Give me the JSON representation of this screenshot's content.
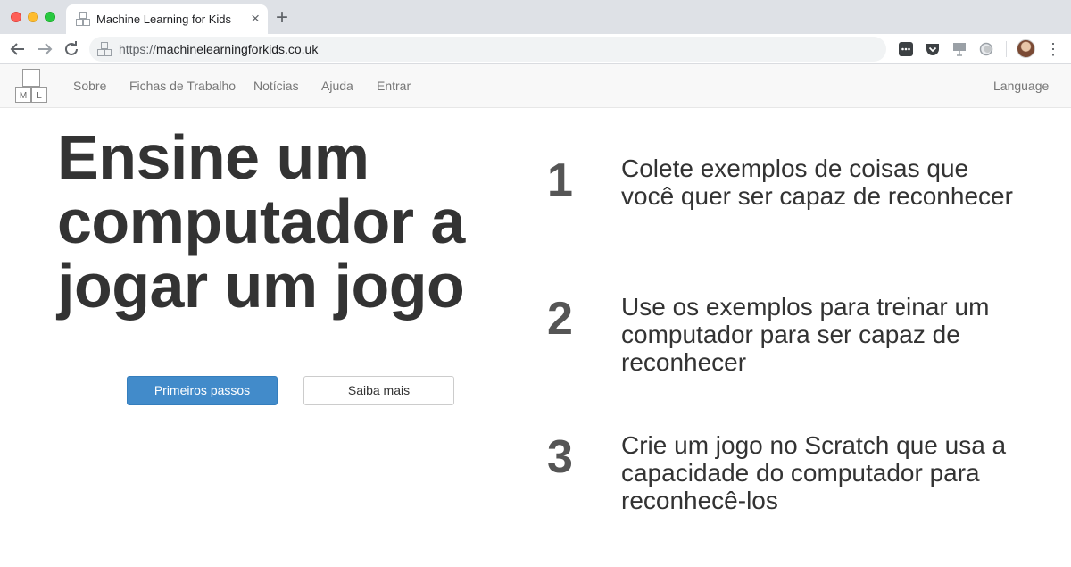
{
  "browser": {
    "tab_title": "Machine Learning for Kids",
    "url_scheme": "https://",
    "url_host": "machinelearningforkids.co.uk",
    "icons": [
      "back-icon",
      "forward-icon",
      "reload-icon",
      "page-info-icon",
      "extension-icon",
      "pocket-icon",
      "presentation-icon",
      "circle-extension-icon",
      "profile-avatar",
      "menu-icon"
    ]
  },
  "site": {
    "logo_letters": [
      "M",
      "L"
    ],
    "nav": {
      "sobre": "Sobre",
      "fichas": "Fichas de Trabalho",
      "noticias": "Notícias",
      "ajuda": "Ajuda",
      "entrar": "Entrar",
      "language": "Language"
    }
  },
  "hero": {
    "title": "Ensine um computador a jogar um jogo",
    "primary_button": "Primeiros passos",
    "secondary_button": "Saiba mais"
  },
  "steps": [
    {
      "number": "1",
      "text": "Colete exemplos de coisas que você quer ser capaz de reconhecer"
    },
    {
      "number": "2",
      "text": "Use os exemplos para treinar um computador para ser capaz de reconhecer"
    },
    {
      "number": "3",
      "text": "Crie um jogo no Scratch que usa a capacidade do computador para reconhecê-los"
    }
  ],
  "colors": {
    "primary": "#428bca",
    "heading": "#333333",
    "nav_text": "#777777"
  }
}
